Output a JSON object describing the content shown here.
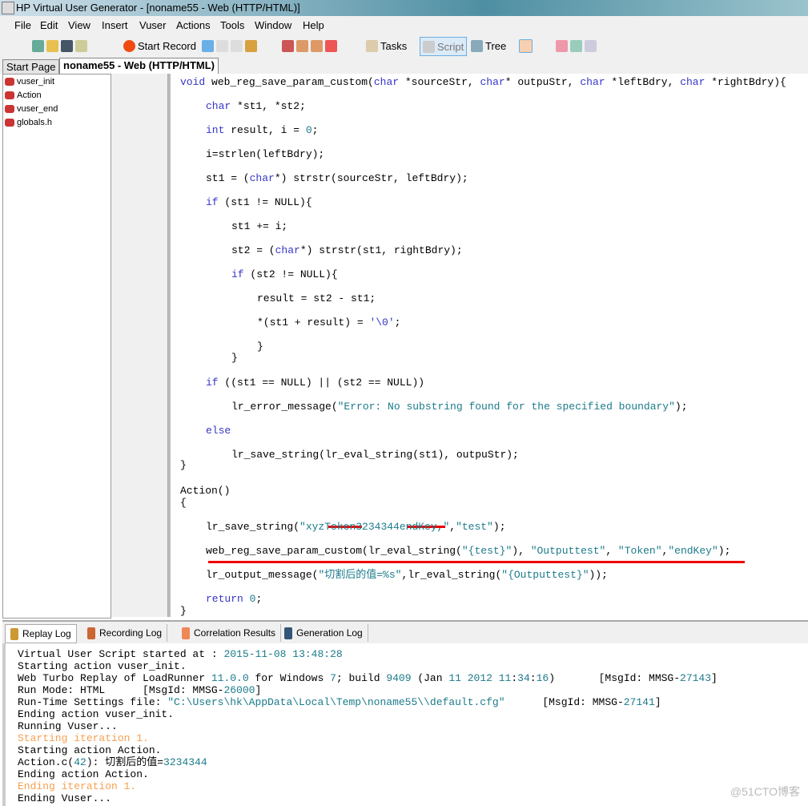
{
  "window": {
    "title": "HP Virtual User Generator - [noname55 - Web (HTTP/HTML)]"
  },
  "menu": [
    "File",
    "Edit",
    "View",
    "Insert",
    "Vuser",
    "Actions",
    "Tools",
    "Window",
    "Help"
  ],
  "toolbar": {
    "start_record": "Start Record",
    "tasks": "Tasks",
    "script": "Script",
    "tree": "Tree"
  },
  "tabs": [
    "Start Page",
    "noname55 - Web (HTTP/HTML)"
  ],
  "tree_items": [
    "vuser_init",
    "Action",
    "vuser_end",
    "globals.h"
  ],
  "code": [
    [
      [
        "void",
        "k"
      ],
      [
        " web_reg_save_param_custom(",
        ""
      ],
      [
        "char",
        "k"
      ],
      [
        " *sourceStr, ",
        ""
      ],
      [
        "char",
        "k"
      ],
      [
        "* outpuStr, ",
        ""
      ],
      [
        "char",
        "k"
      ],
      [
        " *leftBdry, ",
        ""
      ],
      [
        "char",
        "k"
      ],
      [
        " *rightBdry){",
        ""
      ]
    ],
    [
      [
        "char",
        "k"
      ],
      [
        " *st1, *st2;",
        ""
      ]
    ],
    [
      [
        "int",
        "k"
      ],
      [
        " result, i = ",
        ""
      ],
      [
        "0",
        "n"
      ],
      [
        ";",
        ""
      ]
    ],
    [
      [
        "i=strlen(leftBdry);",
        ""
      ]
    ],
    [
      [
        "st1 = (",
        ""
      ],
      [
        "char",
        "k"
      ],
      [
        "*) strstr(sourceStr, leftBdry);",
        ""
      ]
    ],
    [
      [
        "if",
        "k"
      ],
      [
        " (st1 != NULL){",
        ""
      ]
    ],
    [
      [
        "st1 += i;",
        ""
      ]
    ],
    [
      [
        "st2 = (",
        ""
      ],
      [
        "char",
        "k"
      ],
      [
        "*) strstr(st1, rightBdry);",
        ""
      ]
    ],
    [
      [
        "if",
        "k"
      ],
      [
        " (st2 != NULL){",
        ""
      ]
    ],
    [
      [
        "result = st2 - st1;",
        ""
      ]
    ],
    [
      [
        "*(st1 + result) = ",
        ""
      ],
      [
        "'\\0'",
        "k"
      ],
      [
        ";",
        ""
      ]
    ],
    [
      [
        "}",
        ""
      ]
    ],
    [
      [
        "}",
        ""
      ]
    ],
    [
      [
        "if",
        "k"
      ],
      [
        " ((st1 == NULL) || (st2 == NULL))",
        ""
      ]
    ],
    [
      [
        "lr_error_message(",
        ""
      ],
      [
        "\"Error: No substring found for the specified boundary\"",
        "s"
      ],
      [
        ");",
        ""
      ]
    ],
    [
      [
        "else",
        "k"
      ]
    ],
    [
      [
        "lr_save_string(lr_eval_string(st1), outpuStr);",
        ""
      ]
    ],
    [
      [
        "}",
        ""
      ]
    ],
    [
      [
        "Action()",
        ""
      ]
    ],
    [
      [
        "{",
        ""
      ]
    ],
    [
      [
        "lr_save_string(",
        ""
      ],
      [
        "\"xyzToken3234344endKey,\"",
        "s"
      ],
      [
        ",",
        ""
      ],
      [
        "\"test\"",
        "s"
      ],
      [
        ");",
        ""
      ]
    ],
    [
      [
        "web_reg_save_param_custom(lr_eval_string(",
        ""
      ],
      [
        "\"{test}\"",
        "s"
      ],
      [
        "), ",
        ""
      ],
      [
        "\"Outputtest\"",
        "s"
      ],
      [
        ", ",
        ""
      ],
      [
        "\"Token\"",
        "s"
      ],
      [
        ",",
        ""
      ],
      [
        "\"endKey\"",
        "s"
      ],
      [
        ");",
        ""
      ]
    ],
    [
      [
        "lr_output_message(",
        ""
      ],
      [
        "\"切割后的值=%s\"",
        "s"
      ],
      [
        ",lr_eval_string(",
        ""
      ],
      [
        "\"{Outputtest}\"",
        "s"
      ],
      [
        "));",
        ""
      ]
    ],
    [
      [
        "return",
        "k"
      ],
      [
        " ",
        ""
      ],
      [
        "0",
        "n"
      ],
      [
        ";",
        ""
      ]
    ],
    [
      [
        "}",
        ""
      ]
    ]
  ],
  "log_tabs": [
    "Replay Log",
    "Recording Log",
    "Correlation Results",
    "Generation Log"
  ],
  "log": [
    [
      [
        "Virtual User Script started at : ",
        ""
      ],
      [
        "2015-11-08 13:48:28",
        "n"
      ]
    ],
    [
      [
        "Starting action vuser_init.",
        ""
      ]
    ],
    [
      [
        "Web Turbo Replay of LoadRunner ",
        ""
      ],
      [
        "11.0.0",
        "n"
      ],
      [
        " for Windows ",
        ""
      ],
      [
        "7",
        "n"
      ],
      [
        "; build ",
        ""
      ],
      [
        "9409",
        "n"
      ],
      [
        " (Jan ",
        ""
      ],
      [
        "11 2012 11",
        "n"
      ],
      [
        ":",
        ""
      ],
      [
        "34",
        "n"
      ],
      [
        ":",
        ""
      ],
      [
        "16",
        "n"
      ],
      [
        ")       [MsgId: MMSG-",
        ""
      ],
      [
        "27143",
        "n"
      ],
      [
        "]",
        ""
      ]
    ],
    [
      [
        "Run Mode: HTML      [MsgId: MMSG-",
        ""
      ],
      [
        "26000",
        "n"
      ],
      [
        "]",
        ""
      ]
    ],
    [
      [
        "Run-Time Settings file: ",
        ""
      ],
      [
        "\"C:\\Users\\hk\\AppData\\Local\\Temp\\noname55\\\\default.cfg\"",
        "n"
      ],
      [
        "      [MsgId: MMSG-",
        ""
      ],
      [
        "27141",
        "n"
      ],
      [
        "]",
        ""
      ]
    ],
    [
      [
        "Ending action vuser_init.",
        ""
      ]
    ],
    [
      [
        "Running Vuser...",
        ""
      ]
    ],
    [
      [
        "Starting iteration 1.",
        "o"
      ]
    ],
    [
      [
        "Starting action Action.",
        ""
      ]
    ],
    [
      [
        "Action.c(",
        ""
      ],
      [
        "42",
        "n"
      ],
      [
        "): 切割后的值=",
        ""
      ],
      [
        "3234344",
        "n"
      ]
    ],
    [
      [
        "Ending action Action.",
        ""
      ]
    ],
    [
      [
        "Ending iteration 1.",
        "o"
      ]
    ],
    [
      [
        "Ending Vuser...",
        ""
      ]
    ]
  ],
  "watermark": "@51CTO博客"
}
